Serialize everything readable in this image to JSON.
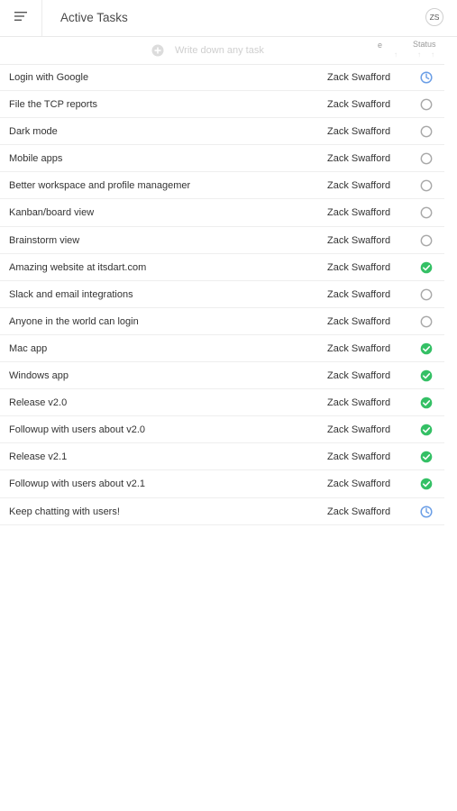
{
  "header": {
    "title": "Active Tasks",
    "menu_icon": "hamburger-icon",
    "avatar_initials": "ZS"
  },
  "new_task": {
    "placeholder": "Write down any task",
    "add_icon": "plus-circle-icon"
  },
  "columns": {
    "assignee_label": "e",
    "status_label": "Status"
  },
  "colors": {
    "in_progress": "#6a9ee6",
    "done": "#34c065",
    "todo": "#a8a8a8"
  },
  "tasks": [
    {
      "title": "Login with Google",
      "assignee": "Zack Swafford",
      "status": "in-progress"
    },
    {
      "title": "File the TCP reports",
      "assignee": "Zack Swafford",
      "status": "todo"
    },
    {
      "title": "Dark mode",
      "assignee": "Zack Swafford",
      "status": "todo"
    },
    {
      "title": "Mobile apps",
      "assignee": "Zack Swafford",
      "status": "todo"
    },
    {
      "title": "Better workspace and profile managemer",
      "assignee": "Zack Swafford",
      "status": "todo"
    },
    {
      "title": "Kanban/board view",
      "assignee": "Zack Swafford",
      "status": "todo"
    },
    {
      "title": "Brainstorm view",
      "assignee": "Zack Swafford",
      "status": "todo"
    },
    {
      "title": "Amazing website at itsdart.com",
      "assignee": "Zack Swafford",
      "status": "done"
    },
    {
      "title": "Slack and email integrations",
      "assignee": "Zack Swafford",
      "status": "todo"
    },
    {
      "title": "Anyone in the world can login",
      "assignee": "Zack Swafford",
      "status": "todo"
    },
    {
      "title": "Mac app",
      "assignee": "Zack Swafford",
      "status": "done"
    },
    {
      "title": "Windows app",
      "assignee": "Zack Swafford",
      "status": "done"
    },
    {
      "title": "Release v2.0",
      "assignee": "Zack Swafford",
      "status": "done"
    },
    {
      "title": "Followup with users about v2.0",
      "assignee": "Zack Swafford",
      "status": "done"
    },
    {
      "title": "Release v2.1",
      "assignee": "Zack Swafford",
      "status": "done"
    },
    {
      "title": "Followup with users about v2.1",
      "assignee": "Zack Swafford",
      "status": "done"
    },
    {
      "title": "Keep chatting with users!",
      "assignee": "Zack Swafford",
      "status": "in-progress"
    }
  ]
}
